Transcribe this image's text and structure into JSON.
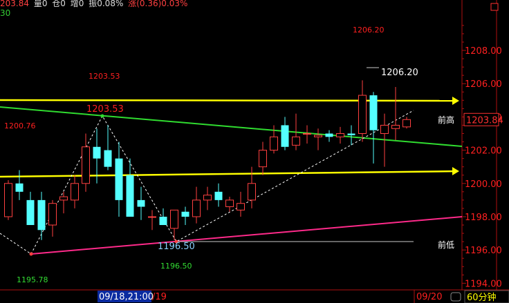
{
  "header": {
    "price": "203.84",
    "vol": "量0",
    "oi": "仓0",
    "inc": "增0",
    "amp": "振0.08%",
    "chg": "涨(0.36)0.03%"
  },
  "period_number": "30",
  "chart_data": {
    "type": "candlestick",
    "ylim": [
      1193.6,
      1210.2
    ],
    "y_ticks": [
      "1194.00",
      "1196.00",
      "1198.00",
      "1200.00",
      "1202.00",
      "1204.00",
      "1206.00",
      "1208.00"
    ],
    "current_price_label": "1203.84",
    "x_labels": [
      "09/18,21:00",
      "/19",
      "09/20"
    ],
    "period_label": "60分钟",
    "candles": [
      {
        "o": 1198.0,
        "h": 1200.2,
        "l": 1197.8,
        "c": 1200.0
      },
      {
        "o": 1200.0,
        "h": 1200.8,
        "l": 1199.0,
        "c": 1199.5
      },
      {
        "o": 1199.0,
        "h": 1199.5,
        "l": 1197.5,
        "c": 1197.5
      },
      {
        "o": 1199.0,
        "h": 1199.5,
        "l": 1196.6,
        "c": 1197.2
      },
      {
        "o": 1197.5,
        "h": 1199.0,
        "l": 1196.8,
        "c": 1198.8
      },
      {
        "o": 1199.0,
        "h": 1199.5,
        "l": 1198.2,
        "c": 1199.2
      },
      {
        "o": 1199.0,
        "h": 1200.5,
        "l": 1198.5,
        "c": 1200.0
      },
      {
        "o": 1200.0,
        "h": 1203.0,
        "l": 1199.5,
        "c": 1202.2
      },
      {
        "o": 1202.2,
        "h": 1203.3,
        "l": 1200.0,
        "c": 1201.5
      },
      {
        "o": 1202.0,
        "h": 1203.5,
        "l": 1200.8,
        "c": 1201.0
      },
      {
        "o": 1201.5,
        "h": 1202.5,
        "l": 1198.0,
        "c": 1199.0
      },
      {
        "o": 1200.5,
        "h": 1201.5,
        "l": 1198.5,
        "c": 1198.0
      },
      {
        "o": 1199.0,
        "h": 1199.8,
        "l": 1197.8,
        "c": 1198.6
      },
      {
        "o": 1198.0,
        "h": 1198.4,
        "l": 1197.2,
        "c": 1198.0
      },
      {
        "o": 1198.0,
        "h": 1198.5,
        "l": 1197.8,
        "c": 1197.5
      },
      {
        "o": 1197.3,
        "h": 1198.2,
        "l": 1196.6,
        "c": 1198.4
      },
      {
        "o": 1198.3,
        "h": 1198.6,
        "l": 1197.5,
        "c": 1198.0
      },
      {
        "o": 1198.0,
        "h": 1199.8,
        "l": 1197.6,
        "c": 1199.0
      },
      {
        "o": 1199.0,
        "h": 1199.8,
        "l": 1198.4,
        "c": 1199.3
      },
      {
        "o": 1199.5,
        "h": 1200.0,
        "l": 1198.6,
        "c": 1199.0
      },
      {
        "o": 1198.6,
        "h": 1199.2,
        "l": 1198.3,
        "c": 1199.0
      },
      {
        "o": 1198.4,
        "h": 1199.5,
        "l": 1198.0,
        "c": 1198.8
      },
      {
        "o": 1199.0,
        "h": 1201.0,
        "l": 1198.5,
        "c": 1200.0
      },
      {
        "o": 1201.0,
        "h": 1202.5,
        "l": 1200.5,
        "c": 1202.0
      },
      {
        "o": 1202.0,
        "h": 1203.5,
        "l": 1201.8,
        "c": 1202.8
      },
      {
        "o": 1203.5,
        "h": 1204.0,
        "l": 1202.0,
        "c": 1202.2
      },
      {
        "o": 1202.3,
        "h": 1204.2,
        "l": 1202.0,
        "c": 1202.8
      },
      {
        "o": 1203.0,
        "h": 1203.5,
        "l": 1202.4,
        "c": 1203.0
      },
      {
        "o": 1202.8,
        "h": 1203.3,
        "l": 1202.0,
        "c": 1202.9
      },
      {
        "o": 1203.0,
        "h": 1203.2,
        "l": 1202.5,
        "c": 1202.8
      },
      {
        "o": 1202.8,
        "h": 1203.4,
        "l": 1202.4,
        "c": 1203.0
      },
      {
        "o": 1203.0,
        "h": 1203.5,
        "l": 1202.3,
        "c": 1202.9
      },
      {
        "o": 1203.0,
        "h": 1206.2,
        "l": 1202.5,
        "c": 1205.3
      },
      {
        "o": 1205.3,
        "h": 1205.5,
        "l": 1201.2,
        "c": 1203.2
      },
      {
        "o": 1203.0,
        "h": 1204.2,
        "l": 1201.0,
        "c": 1203.5
      },
      {
        "o": 1203.3,
        "h": 1205.8,
        "l": 1202.6,
        "c": 1203.5
      },
      {
        "o": 1203.4,
        "h": 1204.0,
        "l": 1203.3,
        "c": 1203.84
      }
    ],
    "annotations": [
      {
        "text": "1206.20",
        "color": "#ff2020"
      },
      {
        "text": "1203.53",
        "color": "#ff2020"
      },
      {
        "text": "1203.53",
        "color": "#ff2020"
      },
      {
        "text": "1200.76",
        "color": "#ff2020"
      },
      {
        "text": "1206.20",
        "color": "#ffffff"
      },
      {
        "text": "1196.50",
        "color": "#8ad0ff"
      },
      {
        "text": "1196.50",
        "color": "#33dd33"
      },
      {
        "text": "1195.78",
        "color": "#33dd33"
      },
      {
        "text": "前高",
        "color": "#ffffff"
      },
      {
        "text": "前低",
        "color": "#ffffff"
      }
    ]
  },
  "colors": {
    "up": "#ff4040",
    "down": "#54ffff",
    "axis": "#b01010",
    "yellow": "#ffff00",
    "green": "#30dd30",
    "magenta": "#ff2a8a"
  }
}
